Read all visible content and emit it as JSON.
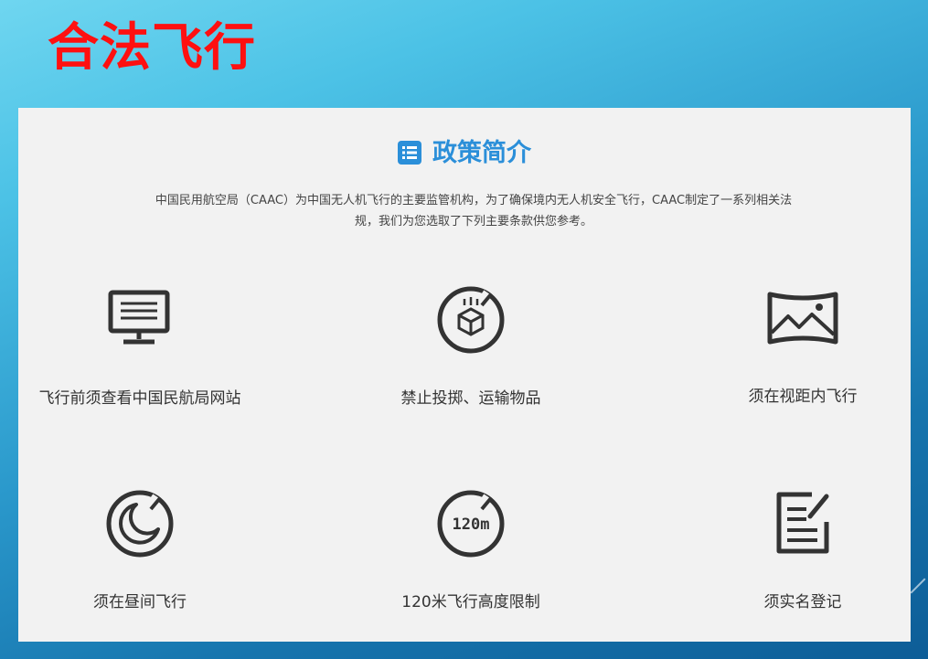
{
  "slide": {
    "title": "合法飞行"
  },
  "panel": {
    "heading": "政策简介",
    "heading_icon": "list-icon",
    "description": "中国民用航空局（CAAC）为中国无人机飞行的主要监管机构，为了确保境内无人机安全飞行，CAAC制定了一系列相关法规，我们为您选取了下列主要条款供您参考。",
    "accent_color": "#2b8fd9",
    "icon_color": "#333333",
    "items": [
      {
        "icon": "monitor-icon",
        "label": "飞行前须查看中国民航局网站"
      },
      {
        "icon": "no-drop-icon",
        "label": "禁止投掷、运输物品"
      },
      {
        "icon": "landscape-view-icon",
        "label": "须在视距内飞行"
      },
      {
        "icon": "no-night-icon",
        "label": "须在昼间飞行"
      },
      {
        "icon": "altitude-limit-icon",
        "icon_text": "120m",
        "label": "120米飞行高度限制"
      },
      {
        "icon": "registration-icon",
        "label": "须实名登记"
      }
    ]
  }
}
